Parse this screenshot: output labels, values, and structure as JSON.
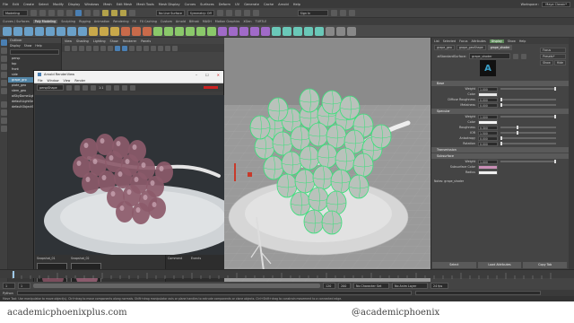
{
  "menubar": {
    "items": [
      "File",
      "Edit",
      "Create",
      "Select",
      "Modify",
      "Display",
      "Windows",
      "Mesh",
      "Edit Mesh",
      "Mesh Tools",
      "Mesh Display",
      "Curves",
      "Surfaces",
      "Deform",
      "UV",
      "Generate",
      "Cache",
      "Arnold",
      "Help"
    ],
    "workspace_label": "Workspace :",
    "workspace_value": "Maya Classic*"
  },
  "statusline": {
    "mode": "Modeling",
    "live_surface": "No Live Surface",
    "symmetry": "Symmetry: Off",
    "sign_in": "Sign In"
  },
  "shelf": {
    "tabs": [
      "Curves / Surfaces",
      "Poly Modeling",
      "Sculpting",
      "Rigging",
      "Animation",
      "Rendering",
      "FX",
      "FX Caching",
      "Custom",
      "Arnold",
      "Bifrost",
      "MASH",
      "Motion Graphics",
      "XGen",
      "TURTLE"
    ],
    "active_tab": "Poly Modeling"
  },
  "outliner": {
    "title": "Outliner",
    "menu": [
      "Display",
      "Show",
      "Help"
    ],
    "items": [
      "persp",
      "top",
      "front",
      "side",
      "grape_grp",
      "plate_geo",
      "stem_geo",
      "aiSkyDomeLight1",
      "defaultLightSet",
      "defaultObjectSet"
    ],
    "selected_index": 4
  },
  "viewport": {
    "menu": [
      "View",
      "Shading",
      "Lighting",
      "Show",
      "Renderer",
      "Panels"
    ],
    "colorspace": "sRGB gamma",
    "value_a": "0.00",
    "value_b": "1.00",
    "camera_label": "persp"
  },
  "render_view": {
    "title": "Arnold RenderView",
    "menu": [
      "File",
      "Window",
      "View",
      "Render"
    ],
    "camera": "perspShape",
    "ratio": "1:1",
    "snapshots": [
      "Snapshot_01",
      "Snapshot_02"
    ],
    "side_tabs": [
      "Comment",
      "Events"
    ],
    "status": "Rendering | 960x540 (40%) | perspShape | samples 1/3/2/2/2/2"
  },
  "attribute_editor": {
    "menu": [
      "List",
      "Selected",
      "Focus",
      "Attributes",
      "Display",
      "Show",
      "Help"
    ],
    "active_menu": "Display",
    "node_tabs": [
      "grape_geo",
      "grape_geoShape",
      "grape_shader"
    ],
    "active_node_tab": "grape_shader",
    "type_label": "aiStandardSurface:",
    "node_name": "grape_shader",
    "focus_btn": "Focus",
    "presets_btn": "Presets*",
    "show_btn": "Show",
    "hide_btn": "Hide",
    "sections": {
      "base": "Base",
      "specular": "Specular",
      "transmission": "Transmission",
      "subsurface": "Subsurface"
    },
    "base_rows": [
      {
        "label": "Weight",
        "value": "1.000",
        "slider": 1.0
      },
      {
        "label": "Color",
        "value": "",
        "slider": null
      },
      {
        "label": "Diffuse Roughness",
        "value": "0.000",
        "slider": 0.0
      },
      {
        "label": "Metalness",
        "value": "0.000",
        "slider": 0.0
      }
    ],
    "specular_rows": [
      {
        "label": "Weight",
        "value": "1.000",
        "slider": 1.0
      },
      {
        "label": "Color",
        "value": "",
        "slider": null
      },
      {
        "label": "Roughness",
        "value": "0.300",
        "slider": 0.3
      },
      {
        "label": "IOR",
        "value": "1.500",
        "slider": 0.3
      },
      {
        "label": "Anisotropy",
        "value": "0.000",
        "slider": 0.0
      },
      {
        "label": "Rotation",
        "value": "0.000",
        "slider": 0.0
      }
    ],
    "subsurface_rows": [
      {
        "label": "Weight",
        "value": "1.000",
        "slider": 1.0
      },
      {
        "label": "Subsurface Color",
        "value": "",
        "slider": null
      },
      {
        "label": "Radius",
        "value": "",
        "slider": null
      }
    ],
    "notes_label": "Notes: grape_shader",
    "buttons": [
      "Select",
      "Load Attributes",
      "Copy Tab"
    ]
  },
  "timeline": {
    "start": "1",
    "end": "120",
    "current": "1",
    "range_end": "200",
    "character_set": "No Character Set",
    "anim_layer": "No Anim Layer",
    "fps": "24 fps"
  },
  "cmdline": {
    "label": "Python"
  },
  "helpline": "Move Tool: Use manipulator to move object(s). Ctrl+drag to move components along normals. Shift+drag manipulator axis or plane handles to extrude components or clone objects. Ctrl+Shift+drag to constrain movement to a connected edge.",
  "banner": {
    "left": "academicphoenixplus.com",
    "right": "@academicphoenix"
  },
  "colors": {
    "accent": "#4a7fb3",
    "wire": "#39e07a",
    "grape": "#8c5a6a",
    "subsurface": "#c98fb6"
  }
}
